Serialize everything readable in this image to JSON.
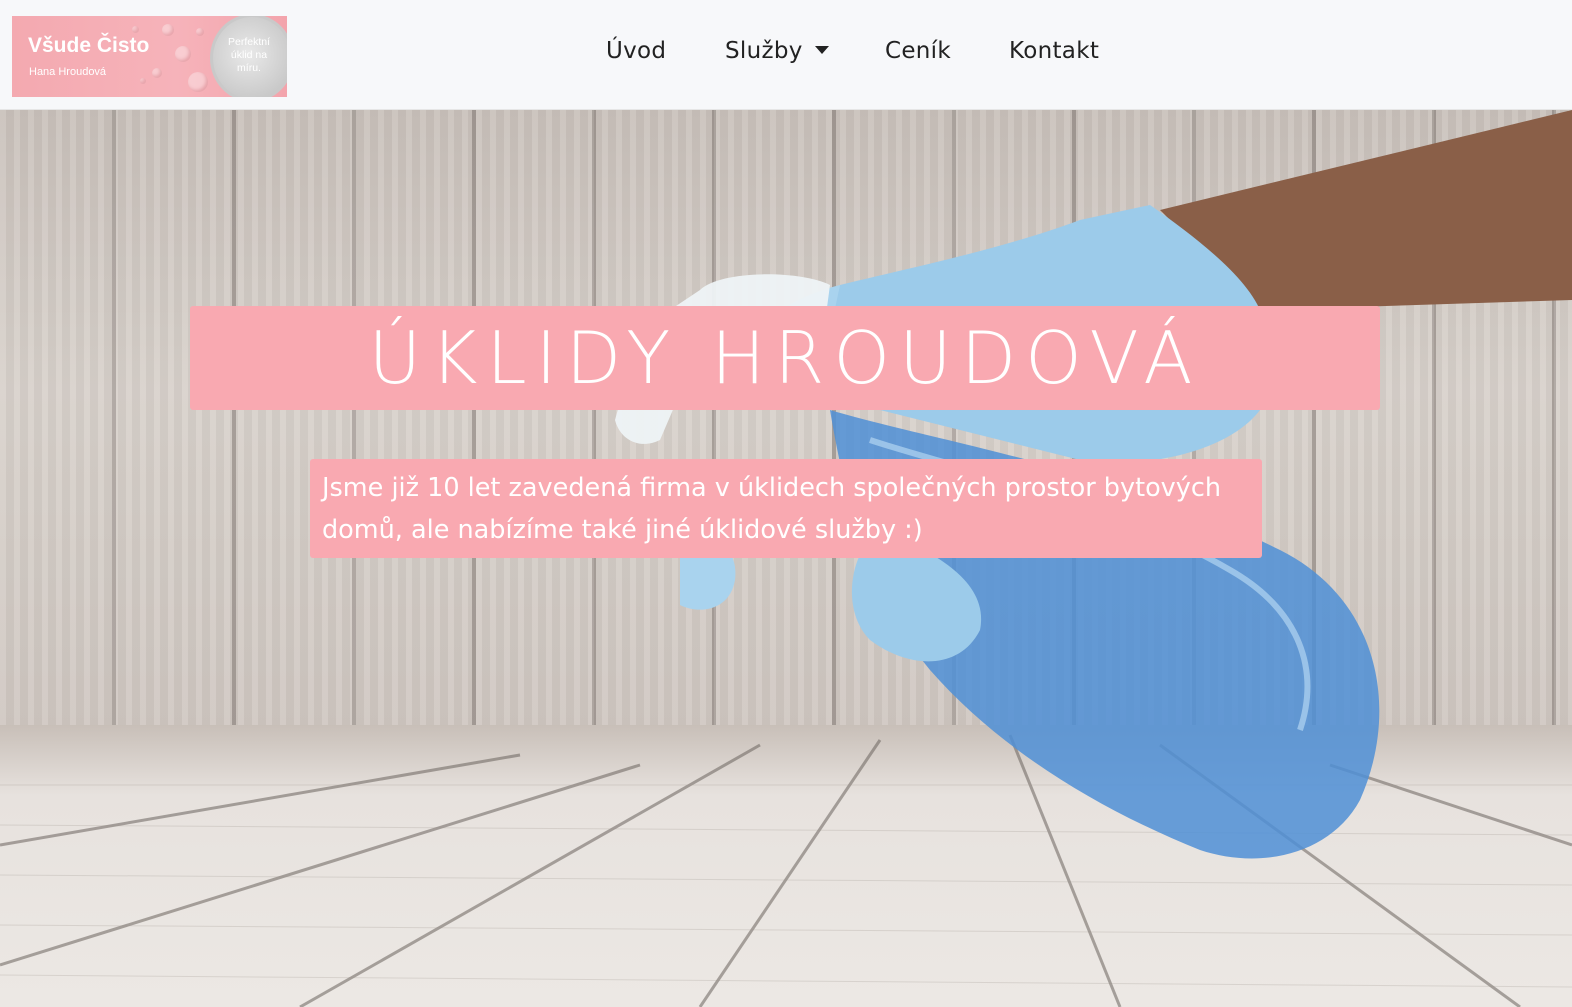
{
  "brand": {
    "logo_title": "Všude Čisto",
    "logo_subtitle": "Hana Hroudová",
    "logo_tagline": "Perfektní úklid na míru."
  },
  "nav": {
    "items": [
      {
        "label": "Úvod"
      },
      {
        "label": "Služby",
        "has_dropdown": true
      },
      {
        "label": "Ceník"
      },
      {
        "label": "Kontakt"
      }
    ]
  },
  "hero": {
    "title": "ÚKLIDY HROUDOVÁ",
    "intro": "Jsme již 10 let zavedená firma v úklidech společných prostor bytových domů, ale nabízíme také jiné úklidové služby :)",
    "background_image": "gloved hand holding blue spray bottle on wooden floor"
  },
  "colors": {
    "accent": "#f9a9b1",
    "navbar_bg": "#f7f8fa",
    "nav_text": "#222222",
    "glove": "#9ccbea",
    "bottle": "#4f8fd6"
  }
}
